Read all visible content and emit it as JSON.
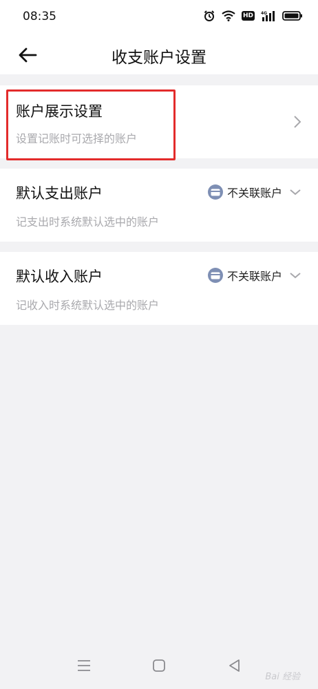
{
  "status_bar": {
    "time": "08:35",
    "icons": [
      "alarm-icon",
      "wifi-icon",
      "hd-icon",
      "signal-4g-icon",
      "battery-icon"
    ],
    "hd_label": "HD",
    "network_label": "4G"
  },
  "header": {
    "back_icon": "arrow-left-icon",
    "title": "收支账户设置"
  },
  "settings": {
    "display": {
      "title": "账户展示设置",
      "description": "设置记账时可选择的账户",
      "highlight_color": "#e32b2b"
    },
    "default_expense": {
      "title": "默认支出账户",
      "description": "记支出时系统默认选中的账户",
      "selected": "不关联账户"
    },
    "default_income": {
      "title": "默认收入账户",
      "description": "记收入时系统默认选中的账户",
      "selected": "不关联账户"
    }
  },
  "nav_bar": {
    "buttons": [
      "menu-icon",
      "home-icon",
      "back-icon"
    ]
  },
  "watermark": "Bai 经验"
}
